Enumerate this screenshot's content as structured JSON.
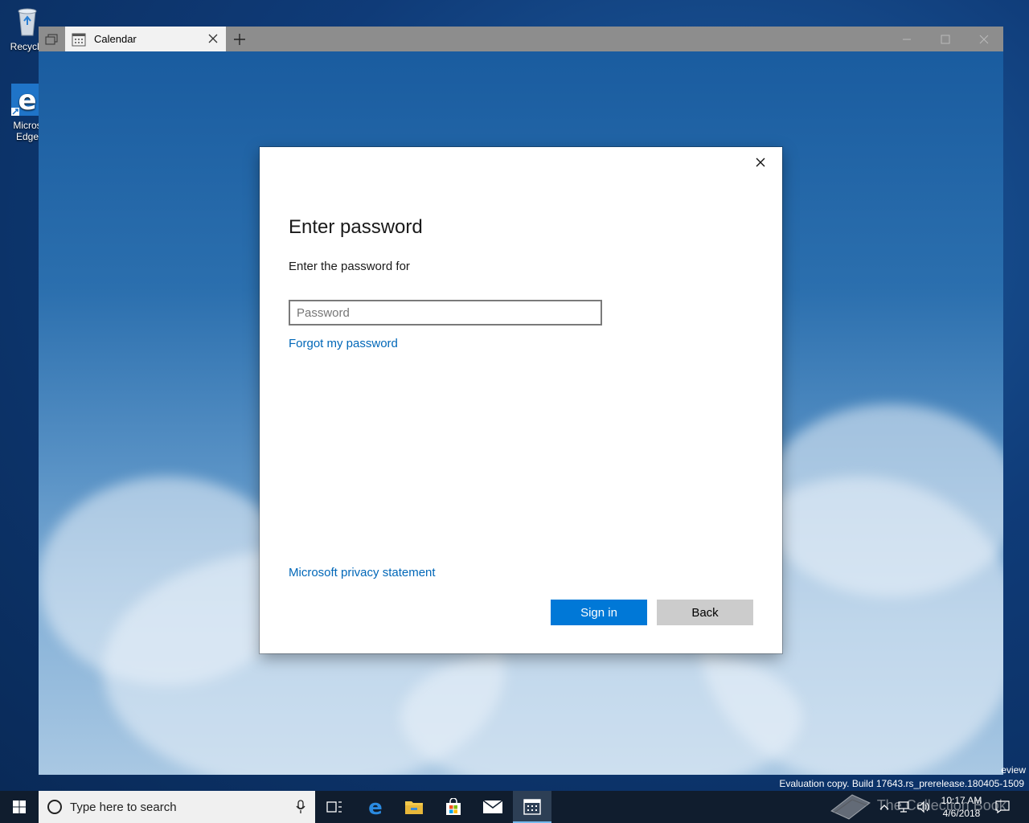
{
  "desktop": {
    "icons": [
      {
        "label": "Recycle"
      },
      {
        "label": "Micros\nEdge"
      }
    ]
  },
  "window": {
    "tab_title": "Calendar"
  },
  "dialog": {
    "title": "Enter password",
    "subtitle": "Enter the password for",
    "password_placeholder": "Password",
    "forgot_link": "Forgot my password",
    "privacy_link": "Microsoft privacy statement",
    "signin_label": "Sign in",
    "back_label": "Back",
    "accent_color": "#0078d7",
    "link_color": "#0067b8"
  },
  "watermark": {
    "eval_line": "Evaluation copy. Build 17643.rs_prerelease.180405-1509",
    "eval_top": "eview",
    "collection": "The Collection Book"
  },
  "taskbar": {
    "search_placeholder": "Type here to search",
    "time": "10:17 AM",
    "date": "4/6/2018"
  }
}
